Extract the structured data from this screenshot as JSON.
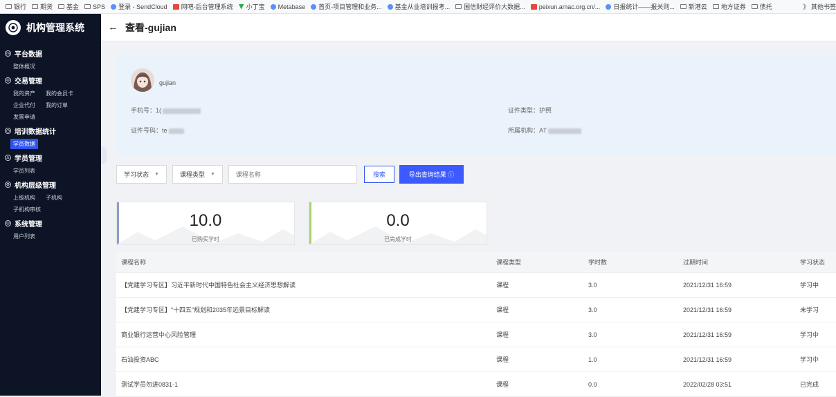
{
  "bookmarks": [
    "银行",
    "期货",
    "基金",
    "SPS",
    "登录 - SendCloud",
    "网吧-后台管理系统",
    "小丁宝",
    "Metabase",
    "首页-项目管理和业务...",
    "基金从业培训报考...",
    "国信财经评价大数据...",
    "peixun.amac.org.cn/...",
    "日报统计——报关则...",
    "新港云",
    "地方证券",
    "债托"
  ],
  "bookmarks_more": "》 其他书签",
  "sidebar": {
    "title": "机构管理系统",
    "groups": [
      {
        "label": "平台数据",
        "items": [
          [
            "整体概况"
          ]
        ]
      },
      {
        "label": "交易管理",
        "items": [
          [
            "我的资产",
            "我的会员卡"
          ],
          [
            "企业代付",
            "我的订单"
          ],
          [
            "发票申请"
          ]
        ]
      },
      {
        "label": "培训数据统计",
        "items": [
          [
            "学员数据"
          ]
        ]
      },
      {
        "label": "学员管理",
        "items": [
          [
            "学员列表"
          ]
        ]
      },
      {
        "label": "机构层级管理",
        "items": [
          [
            "上级机构",
            "子机构"
          ],
          [
            "子机构审核"
          ]
        ]
      },
      {
        "label": "系统管理",
        "items": [
          [
            "用户列表"
          ]
        ]
      }
    ],
    "active_item": "学员数据"
  },
  "header": {
    "title": "查看-gujian"
  },
  "profile": {
    "name": "gujian",
    "phone_label": "手机号：",
    "phone_value": "1(",
    "id_type_label": "证件类型：",
    "id_type_value": "护照",
    "id_no_label": "证件号码：",
    "id_no_value": "te",
    "org_label": "所属机构：",
    "org_value": "AT"
  },
  "filters": {
    "status_label": "学习状态",
    "type_label": "课程类型",
    "course_placeholder": "课程名称",
    "search_label": "搜索",
    "export_label": "导出查询结果 ⓘ"
  },
  "stats": [
    {
      "value": "10.0",
      "label": "已购买学时",
      "color": "#8c9ccd"
    },
    {
      "value": "0.0",
      "label": "已完成学时",
      "color": "#a6d36a"
    }
  ],
  "table": {
    "columns": [
      "课程名称",
      "课程类型",
      "学时数",
      "过期时间",
      "学习状态"
    ],
    "rows": [
      [
        "【党建学习专区】习近平新时代中国特色社会主义经济思想解读",
        "课程",
        "3.0",
        "2021/12/31 16:59",
        "学习中"
      ],
      [
        "【党建学习专区】“十四五”规划和2035年远景目标解读",
        "课程",
        "3.0",
        "2021/12/31 16:59",
        "未学习"
      ],
      [
        "商业银行运营中心风险管理",
        "课程",
        "3.0",
        "2021/12/31 16:59",
        "学习中"
      ],
      [
        "石油投资ABC",
        "课程",
        "1.0",
        "2021/12/31 16:59",
        "学习中"
      ],
      [
        "测试学员勿进0831-1",
        "课程",
        "0.0",
        "2022/02/28 03:51",
        "已完成"
      ]
    ]
  }
}
